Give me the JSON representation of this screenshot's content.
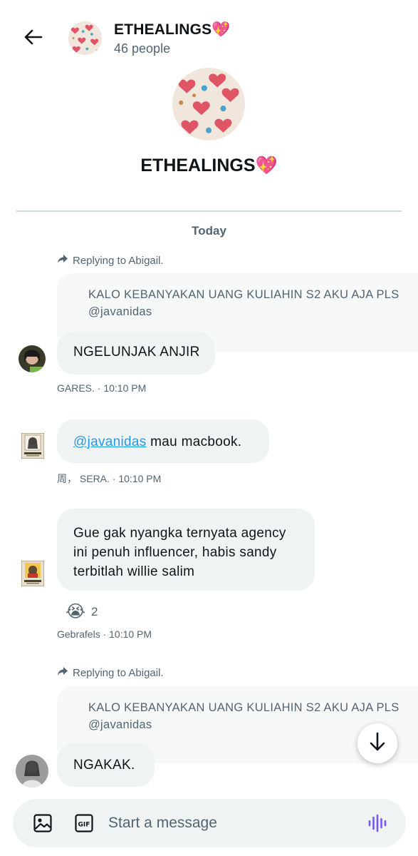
{
  "header": {
    "title": "ETHEALINGS💖",
    "member_count": "46 people"
  },
  "group": {
    "name": "ETHEALINGS💖"
  },
  "day_separator": "Today",
  "messages": [
    {
      "reply_to": "Replying to Abigail.",
      "quote_line1": "KALO KEBANYAKAN UANG KULIAHIN S2 AKU AJA PLS",
      "quote_line2": "@javanidas",
      "text": "NGELUNJAK ANJIR",
      "meta": "GARES. · 10:10 PM"
    },
    {
      "mention": "@javanidas",
      "text": " mau macbook.",
      "meta": "周， SERA. · 10:10 PM"
    },
    {
      "line1": "Gue gak nyangka ternyata agency",
      "line2": "ini penuh influencer, habis sandy",
      "line3": "terbitlah willie salim",
      "reaction_emoji": "😭",
      "reaction_count": "2",
      "meta": "Gebrafels · 10:10 PM"
    },
    {
      "reply_to": "Replying to Abigail.",
      "quote_line1": "KALO KEBANYAKAN UANG KULIAHIN S2 AKU AJA PLS",
      "quote_line2": "@javanidas",
      "text": "NGAKAK."
    }
  ],
  "composer": {
    "placeholder": "Start a message"
  },
  "colors": {
    "accent": "#1d9bf0",
    "secondary_text": "#536471",
    "bubble": "#eff3f4",
    "voice_icon": "#7856ff"
  }
}
